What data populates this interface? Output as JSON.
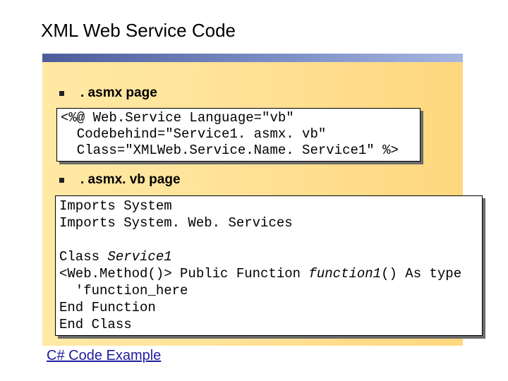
{
  "slide": {
    "title": "XML Web Service Code",
    "link_label": "C# Code Example"
  },
  "bullets": [
    {
      "label": ". asmx page"
    },
    {
      "label": ". asmx. vb page"
    }
  ],
  "code_asmx": {
    "line1": "<%@ Web.Service Language=\"vb\"",
    "line2": "  Codebehind=\"Service1. asmx. vb\"",
    "line3": "  Class=\"XMLWeb.Service.Name. Service1\" %>"
  },
  "code_vb": {
    "line1": "Imports System",
    "line2": "Imports System. Web. Services",
    "line3_a": "Class ",
    "line3_b": "Service1",
    "line4_a": "<Web.Method()> Public Function ",
    "line4_b": "function1",
    "line4_c": "() As type",
    "line5": "  'function_here",
    "line6": "End Function",
    "line7": "End Class"
  },
  "colors": {
    "panel": "#ffe39a",
    "bar": "#7f92c8",
    "link": "#1d1d9e"
  }
}
